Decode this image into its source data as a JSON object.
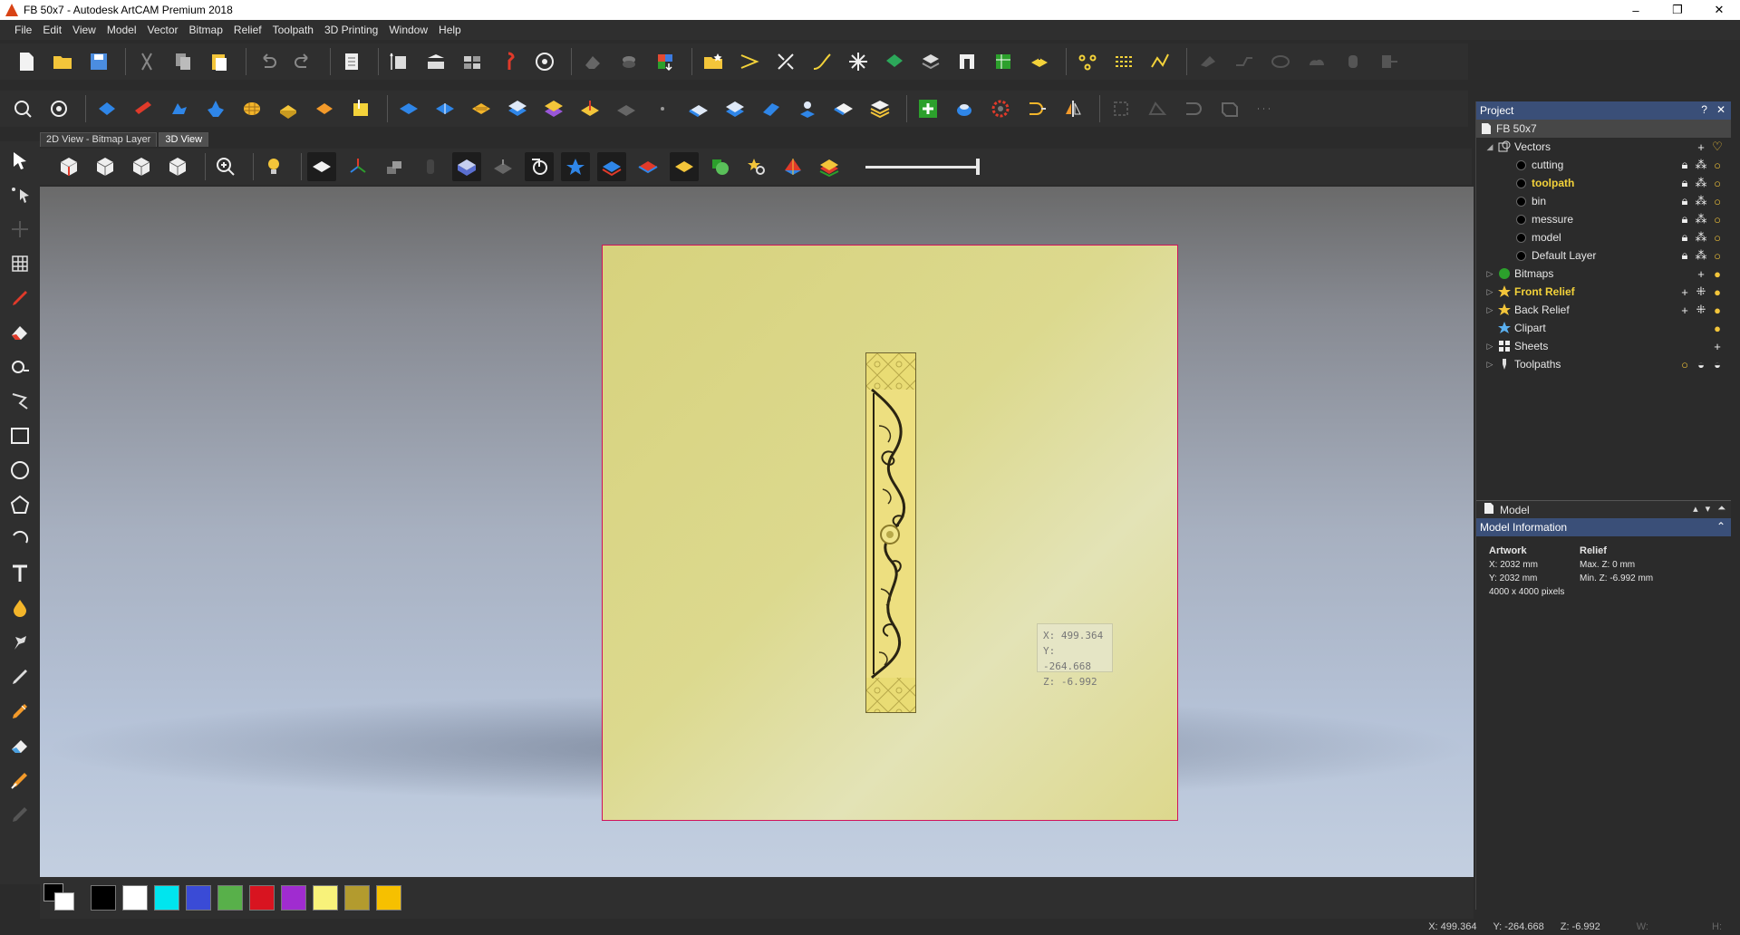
{
  "window": {
    "title": "FB 50x7 - Autodesk ArtCAM Premium 2018",
    "controls": [
      "–",
      "❐",
      "✕"
    ]
  },
  "menu": [
    "File",
    "Edit",
    "View",
    "Model",
    "Vector",
    "Bitmap",
    "Relief",
    "Toolpath",
    "3D Printing",
    "Window",
    "Help"
  ],
  "view_tabs": [
    "2D View - Bitmap Layer",
    "3D View"
  ],
  "active_tab": "3D View",
  "coord_tooltip": {
    "x": "X: 499.364",
    "y": "Y: -264.668",
    "z": "Z: -6.992"
  },
  "status": {
    "x": "X: 499.364",
    "y": "Y: -264.668",
    "z": "Z: -6.992",
    "w": "W:",
    "h": "H:"
  },
  "palette": [
    "#000000",
    "#ffffff",
    "#00e5ee",
    "#3a4bd6",
    "#58b04a",
    "#d81420",
    "#a02cd0",
    "#f8f27a",
    "#b39b2e",
    "#f6c000"
  ],
  "project_panel": {
    "title": "Project",
    "help": "?",
    "close": "✕",
    "root": "FB 50x7",
    "vectors": "Vectors",
    "layers": [
      "cutting",
      "toolpath",
      "bin",
      "messure",
      "model",
      "Default Layer"
    ],
    "active_layer": "toolpath",
    "items": [
      "Bitmaps",
      "Front Relief",
      "Back Relief",
      "Clipart",
      "Sheets",
      "Toolpaths"
    ]
  },
  "model_section": {
    "label": "Model"
  },
  "model_info": {
    "title": "Model Information",
    "artwork_h": "Artwork",
    "artwork": [
      "X: 2032 mm",
      "Y: 2032 mm",
      "4000 x 4000 pixels"
    ],
    "relief_h": "Relief",
    "relief": [
      "Max. Z: 0 mm",
      "Min. Z: -6.992 mm"
    ]
  }
}
